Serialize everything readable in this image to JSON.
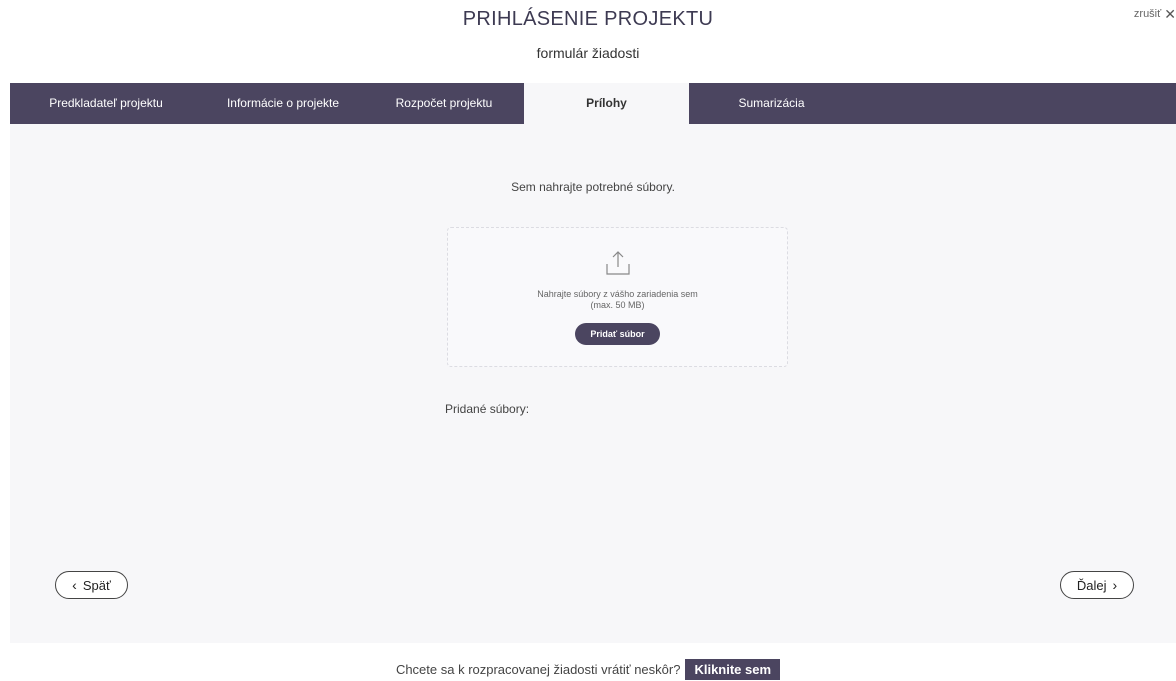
{
  "header": {
    "title": "PRIHLÁSENIE PROJEKTU",
    "subtitle": "formulár žiadosti",
    "cancel_label": "zrušiť",
    "cancel_icon": "close-icon"
  },
  "tabs": [
    {
      "label": "Predkladateľ projektu",
      "active": false
    },
    {
      "label": "Informácie o projekte",
      "active": false
    },
    {
      "label": "Rozpočet projektu",
      "active": false
    },
    {
      "label": "Prílohy",
      "active": true
    },
    {
      "label": "Sumarizácia",
      "active": false
    }
  ],
  "upload": {
    "intro": "Sem nahrajte potrebné súbory.",
    "drop_text_line1": "Nahrajte súbory z vášho zariadenia sem",
    "drop_text_line2": "(max. 50 MB)",
    "add_button": "Pridať súbor",
    "icon": "upload-icon",
    "added_files_label": "Pridané súbory:"
  },
  "navigation": {
    "back_label": "Späť",
    "next_label": "Ďalej"
  },
  "footer": {
    "question": "Chcete sa k rozpracovanej žiadosti vrátiť neskôr?",
    "button": "Kliknite sem"
  },
  "colors": {
    "accent": "#4b4560",
    "panel": "#f7f7f9"
  }
}
